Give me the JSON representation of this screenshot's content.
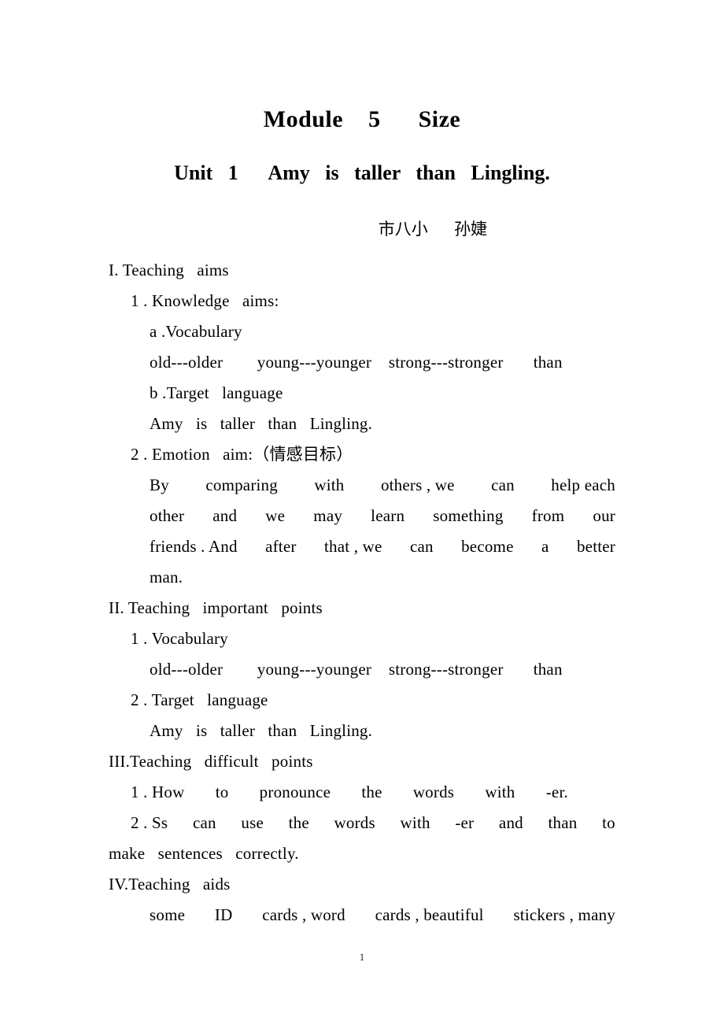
{
  "document": {
    "title": "Module    5      Size",
    "subtitle": "Unit   1      Amy   is   taller   than   Lingling.",
    "byline": "市八小     孙婕",
    "page_number": "1"
  },
  "body": {
    "lines": [
      {
        "id": "l01",
        "indent": "lvl0",
        "text": "I. Teaching   aims"
      },
      {
        "id": "l02",
        "indent": "lvl1",
        "text": "1 . Knowledge   aims:"
      },
      {
        "id": "l03",
        "indent": "lvl2",
        "text": "a .Vocabulary"
      },
      {
        "id": "l04",
        "indent": "lvl2",
        "text": "old---older        young---younger    strong---stronger       than"
      },
      {
        "id": "l05",
        "indent": "lvl2",
        "text": "b .Target   language"
      },
      {
        "id": "l06",
        "indent": "lvl2",
        "text": "Amy   is   taller   than   Lingling."
      },
      {
        "id": "l07",
        "indent": "lvl1",
        "text": "2 . Emotion   aim:（情感目标）"
      },
      {
        "id": "l08",
        "indent": "lvl0",
        "justified": true,
        "first": true,
        "words": [
          "By",
          "comparing",
          "with",
          "others , we",
          "can",
          "help each"
        ]
      },
      {
        "id": "l09",
        "indent": "lvl2",
        "justified": true,
        "words": [
          "other",
          "and",
          "we",
          "may",
          "learn",
          "something",
          "from",
          "our"
        ]
      },
      {
        "id": "l10",
        "indent": "lvl2",
        "justified": true,
        "words": [
          "friends . And",
          "after",
          "that , we",
          "can",
          "become",
          "a",
          "better"
        ]
      },
      {
        "id": "l11",
        "indent": "lvl2",
        "text": "man."
      },
      {
        "id": "l12",
        "indent": "lvl0",
        "text": "II. Teaching   important   points"
      },
      {
        "id": "l13",
        "indent": "lvl1",
        "text": "1 . Vocabulary"
      },
      {
        "id": "l14",
        "indent": "lvl2",
        "text": "old---older        young---younger    strong---stronger       than"
      },
      {
        "id": "l15",
        "indent": "lvl1",
        "text": "2 . Target   language"
      },
      {
        "id": "l16",
        "indent": "lvl2",
        "text": "Amy   is   taller   than   Lingling."
      },
      {
        "id": "l17",
        "indent": "lvl0",
        "text": "III.Teaching   difficult   points"
      },
      {
        "id": "l18",
        "indent": "lvl1",
        "justified": true,
        "words": [
          "1 . How",
          "to",
          "pronounce",
          "the",
          "words",
          "with",
          "-er."
        ],
        "loose": true
      },
      {
        "id": "l19",
        "indent": "lvl1",
        "justified": true,
        "words": [
          "2 . Ss",
          "can",
          "use",
          "the",
          "words",
          "with",
          "-er",
          "and",
          "than",
          "to"
        ]
      },
      {
        "id": "l20",
        "indent": "lvl0",
        "text": "make   sentences   correctly."
      },
      {
        "id": "l21",
        "indent": "lvl0",
        "text": "IV.Teaching   aids"
      },
      {
        "id": "l22",
        "indent": "lvl2",
        "justified": true,
        "words": [
          "some",
          "ID",
          "cards , word",
          "cards , beautiful",
          "stickers , many"
        ]
      }
    ]
  }
}
